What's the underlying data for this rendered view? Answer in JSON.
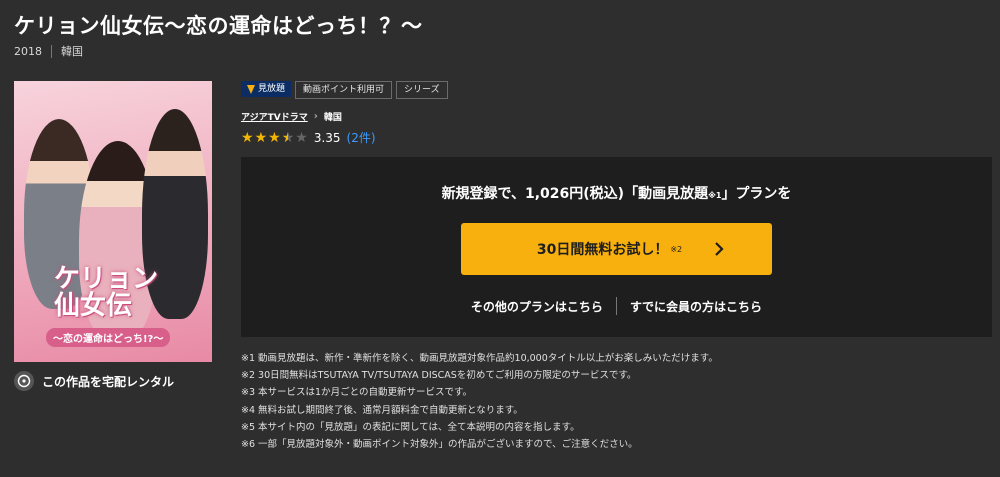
{
  "title": "ケリョン仙女伝〜恋の運命はどっち！？〜",
  "meta": {
    "year": "2018",
    "country": "韓国"
  },
  "poster": {
    "title": "ケリョン\n仙女伝",
    "subtitle": "〜恋の運命はどっち!?〜"
  },
  "rental_label": "この作品を宅配レンタル",
  "tags": {
    "mihodai": "見放題",
    "points": "動画ポイント利用可",
    "series": "シリーズ"
  },
  "breadcrumb": {
    "genre": "アジアTVドラマ",
    "country": "韓国"
  },
  "rating": {
    "score": "3.35",
    "count": "(2件)",
    "stars_value": 3.5,
    "stars_max": 5
  },
  "panel": {
    "headline_pre": "新規登録で、1,026円(税込)「動画見放題",
    "headline_note": "※1",
    "headline_post": "」プランを",
    "trial_label": "30日間無料お試し！",
    "trial_note": "※2",
    "other_plans": "その他のプランはこちら",
    "members": "すでに会員の方はこちら"
  },
  "notes": [
    "※1 動画見放題は、新作・準新作を除く、動画見放題対象作品約10,000タイトル以上がお楽しみいただけます。",
    "※2 30日間無料はTSUTAYA TV/TSUTAYA DISCASを初めてご利用の方限定のサービスです。",
    "※3 本サービスは1か月ごとの自動更新サービスです。",
    "※4 無料お試し期間終了後、通常月額料金で自動更新となります。",
    "※5 本サイト内の「見放題」の表記に関しては、全て本説明の内容を指します。",
    "※6 一部「見放題対象外・動画ポイント対象外」の作品がございますので、ご注意ください。"
  ],
  "colors": {
    "accent": "#f7b00e",
    "star": "#f2b705",
    "link": "#3a9bff",
    "panel": "#1e1e1e",
    "badge": "#0b2d63"
  }
}
